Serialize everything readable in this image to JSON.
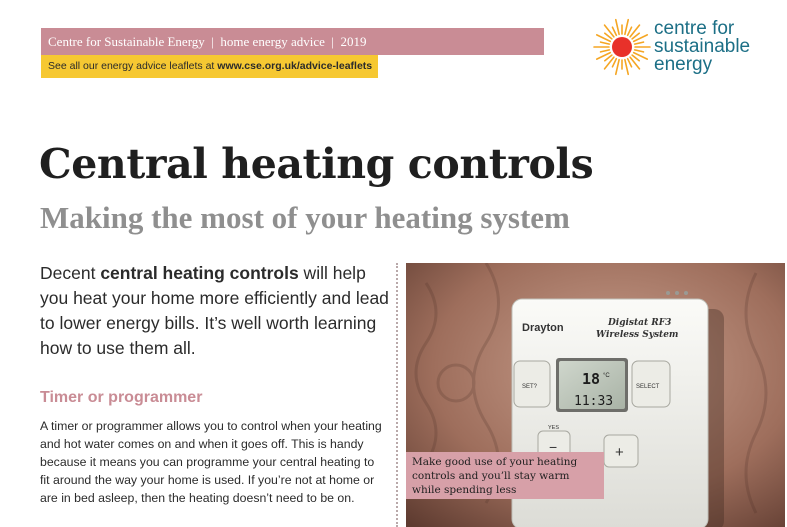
{
  "header": {
    "org": "Centre for Sustainable Energy",
    "sep1": "|",
    "series": "home energy advice",
    "sep2": "|",
    "year": "2019"
  },
  "link_bar": {
    "text_prefix": "See all our energy advice leaflets at ",
    "url": "www.cse.org.uk/advice-leaflets"
  },
  "logo": {
    "line1": "centre for",
    "line2": "sustainable",
    "line3": "energy",
    "sun_color": "#e8312a",
    "ray_color": "#f5a623",
    "text_color": "#1c6f86"
  },
  "title": "Central heating controls",
  "subtitle": "Making the most of your heating system",
  "intro": {
    "before": "Decent ",
    "bold": "central heating controls",
    "after": " will help you heat your home more efficiently and lead to lower energy bills. It’s well worth learning how to use them all."
  },
  "section": {
    "heading": "Timer or programmer",
    "body": "A timer or programmer allows you to control when your heating and hot water comes on and when it goes off. This is handy because it means you can programme your central heating to fit around the way your home is used. If you’re not at home or are in bed asleep, then the heating doesn’t need to be on."
  },
  "photo": {
    "brand": "Drayton",
    "model_line1": "Digistat RF3",
    "model_line2": "Wireless System",
    "set_label": "SET?",
    "select_label": "SELECT",
    "yes_label": "YES",
    "minus_label": "−",
    "plus_label": "+",
    "temp": "18",
    "temp_unit": "°C",
    "time": "11:33"
  },
  "caption": "Make good use of your heating controls and you’ll stay warm while spending less",
  "colors": {
    "header_bg": "#c98c95",
    "link_bg": "#f6c832",
    "heading_pink": "#c98c95",
    "caption_bg": "#d7a0a8"
  }
}
